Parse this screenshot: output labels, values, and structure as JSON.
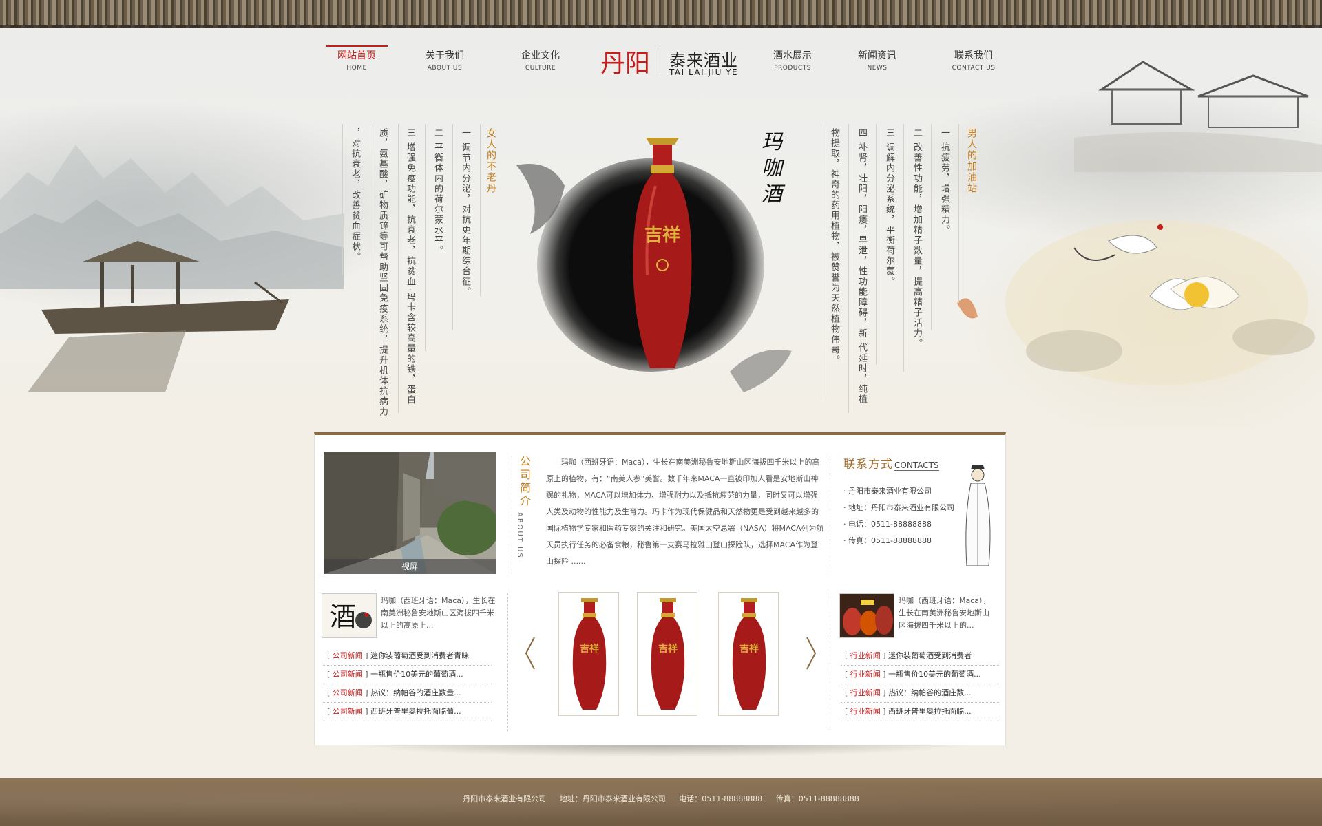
{
  "nav": {
    "left": [
      {
        "cn": "网站首页",
        "en": "HOME",
        "active": true
      },
      {
        "cn": "关于我们",
        "en": "ABOUT US"
      },
      {
        "cn": "企业文化",
        "en": "CULTURE"
      }
    ],
    "right": [
      {
        "cn": "酒水展示",
        "en": "PRODUCTS"
      },
      {
        "cn": "新闻资讯",
        "en": "NEWS"
      },
      {
        "cn": "联系我们",
        "en": "CONTACT US"
      }
    ]
  },
  "logo": {
    "mark": "丹阳",
    "cn": "泰来酒业",
    "en": "TAI LAI JIU YE"
  },
  "hero": {
    "calligraphy": "玛咖酒",
    "bottle_label": "吉祥",
    "women": {
      "title": "女人的不老丹",
      "lines": [
        "一 调节内分泌，对抗更年期综合征。",
        "二 平衡体内的荷尔蒙水平。",
        "三 增强免疫功能，抗衰老，抗贫血-玛卡含较高量的铁，蛋白",
        "质，氨基酸，矿物质锌等可帮助坚固免疫系统，提升机体抗病力",
        "，对抗衰老，改善贫血症状。"
      ]
    },
    "men": {
      "title": "男人的加油站",
      "lines": [
        "一 抗疲劳，增强精力。",
        "二 改善性功能，增加精子数量，提高精子活力。",
        "三 调解内分泌系统，平衡荷尔蒙。",
        "四 补肾，壮阳，阳痿，早泄，性功能障碍，新  代延时，纯植",
        "物提取，神奇的药用植物，被赞誉为天然植物伟哥。"
      ]
    }
  },
  "about": {
    "photo_caption": "视屏",
    "label_cn": "公司简介",
    "label_en": "ABOUT US",
    "text": "玛咖（西班牙语：Maca），生长在南美洲秘鲁安地斯山区海拔四千米以上的高原上的植物，有：“南美人参”美誉。数千年来MACA一直被印加人看是安地斯山神赐的礼物，MACA可以增加体力、增强耐力以及抵抗疲劳的力量，同时又可以增强人类及动物的性能力及生育力。玛卡作为现代保健品和天然物更是受到越来越多的国际植物学专家和医药专家的关注和研究。美国太空总署（NASA）将MACA列为航天员执行任务的必备食粮，秘鲁第一支赛马拉雅山登山探险队，选择MACA作为登山探险 ......"
  },
  "contact": {
    "title_cn": "联系方式",
    "title_en": "CONTACTS",
    "items": [
      "丹阳市泰来酒业有限公司",
      "地址：丹阳市泰来酒业有限公司",
      "电话：0511-88888888",
      "传真：0511-88888888"
    ]
  },
  "company_news": {
    "thumb_text": "酒",
    "summary": "玛咖（西班牙语：Maca），生长在南美洲秘鲁安地斯山区海拔四千米以上的高原上...",
    "tag": "公司新闻",
    "items": [
      "迷你装葡萄酒受到消费者青睐",
      "一瓶售价10美元的葡萄酒...",
      "热议：纳帕谷的酒庄数量...",
      "西班牙普里奥拉托面临葡..."
    ]
  },
  "industry_news": {
    "summary": "玛咖（西班牙语：Maca），生长在南美洲秘鲁安地斯山区海拔四千米以上的...",
    "tag": "行业新闻",
    "items": [
      "迷你装葡萄酒受到消费者",
      "一瓶售价10美元的葡萄酒...",
      "热议：纳帕谷的酒庄数...",
      "西班牙普里奥拉托面临..."
    ]
  },
  "footer": {
    "company": "丹阳市泰来酒业有限公司",
    "address": "地址：丹阳市泰来酒业有限公司",
    "phone": "电话：0511-88888888",
    "fax": "传真：0511-88888888"
  },
  "colors": {
    "accent": "#c51c1c",
    "gold": "#c37c1b",
    "bottle": "#b21e1e",
    "footer": "#7b6449"
  }
}
